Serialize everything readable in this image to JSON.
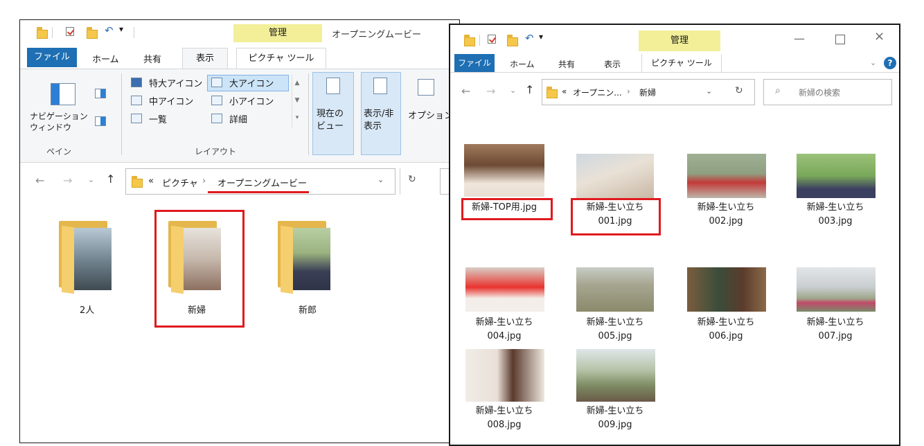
{
  "left_window": {
    "title": "オープニングムービー",
    "manage_label": "管理",
    "tabs": [
      "ファイル",
      "ホーム",
      "共有",
      "表示",
      "ピクチャ ツール"
    ],
    "ribbon": {
      "nav_pane_label": "ナビゲーション\nウィンドウ",
      "pane_group": "ペイン",
      "layout_items": [
        "特大アイコン",
        "大アイコン",
        "中アイコン",
        "小アイコン",
        "一覧",
        "詳細"
      ],
      "layout_group": "レイアウト",
      "current_view": "現在の\nビュー",
      "show_hide": "表示/非\n表示",
      "options": "オプション"
    },
    "breadcrumb": [
      "«",
      "ピクチャ",
      "›",
      "オープニングムービー"
    ],
    "folders": [
      "2人",
      "新婦",
      "新郎"
    ]
  },
  "right_window": {
    "manage_label": "管理",
    "tabs": [
      "ファイル",
      "ホーム",
      "共有",
      "表示",
      "ピクチャ ツール"
    ],
    "breadcrumb": [
      "«",
      "オープニン...",
      "›",
      "新婦"
    ],
    "search_placeholder": "新婦の検索",
    "files": [
      {
        "line1": "新婦-TOP用.jpg",
        "line2": ""
      },
      {
        "line1": "新婦-生い立ち",
        "line2": "001.jpg"
      },
      {
        "line1": "新婦-生い立ち",
        "line2": "002.jpg"
      },
      {
        "line1": "新婦-生い立ち",
        "line2": "003.jpg"
      },
      {
        "line1": "新婦-生い立ち",
        "line2": "004.jpg"
      },
      {
        "line1": "新婦-生い立ち",
        "line2": "005.jpg"
      },
      {
        "line1": "新婦-生い立ち",
        "line2": "006.jpg"
      },
      {
        "line1": "新婦-生い立ち",
        "line2": "007.jpg"
      },
      {
        "line1": "新婦-生い立ち",
        "line2": "008.jpg"
      },
      {
        "line1": "新婦-生い立ち",
        "line2": "009.jpg"
      }
    ]
  },
  "colors": {
    "accent": "#1e6fb3",
    "manage": "#f2ef98",
    "highlight_red": "#e0191e"
  }
}
